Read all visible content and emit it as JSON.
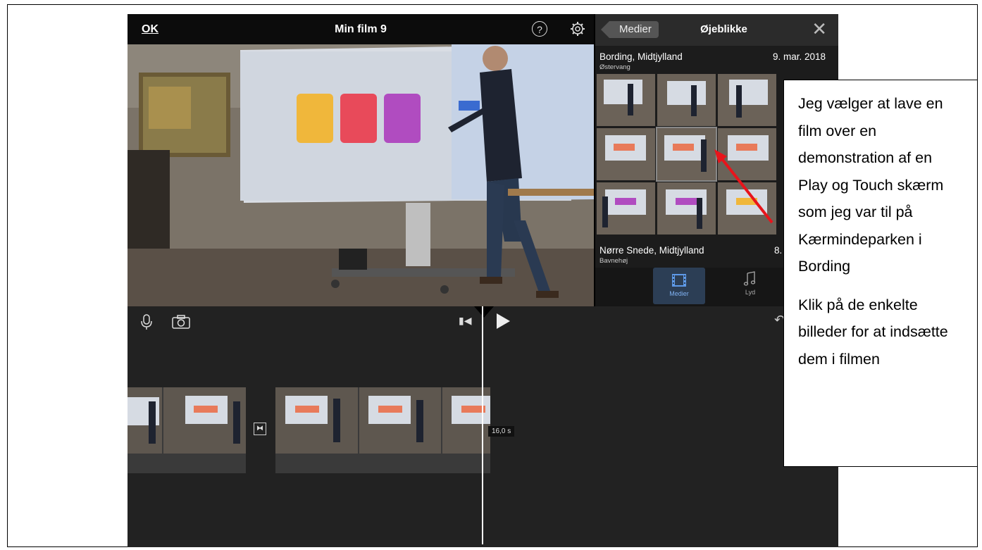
{
  "app": {
    "ok_label": "OK",
    "title": "Min film 9",
    "help_glyph": "?"
  },
  "media_panel": {
    "back_label": "Medier",
    "title": "Øjeblikke",
    "close_glyph": "✕",
    "groups": [
      {
        "place": "Bording, Midtjylland",
        "sub": "Østervang",
        "date": "9. mar. 2018"
      },
      {
        "place": "Nørre Snede, Midtjylland",
        "sub": "Bavnehøj",
        "date": "8."
      }
    ],
    "tabs": [
      {
        "label": "Medier",
        "icon": "film-icon"
      },
      {
        "label": "Lyd",
        "icon": "music-note-icon"
      }
    ]
  },
  "timeline": {
    "duration": "16,0 s"
  },
  "callout": {
    "paragraph1": "Jeg vælger at lave en film over en demonstration af en Play og Touch skærm som jeg var til på Kærmindeparken i Bording",
    "paragraph2": "Klik på de enkelte billeder for at indsætte dem i filmen"
  },
  "colors": {
    "arrow": "#e8141b",
    "tab_active": "#2c3e55"
  }
}
